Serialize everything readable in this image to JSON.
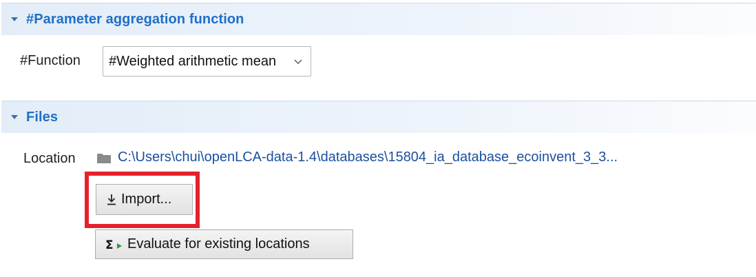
{
  "sections": {
    "parameter_aggregation": {
      "title": "#Parameter aggregation function",
      "function_label": "#Function",
      "function_selected": "#Weighted arithmetic mean"
    },
    "files": {
      "title": "Files",
      "location_label": "Location",
      "location_path": "C:\\Users\\chui\\openLCA-data-1.4\\databases\\15804_ia_database_ecoinvent_3_3...",
      "import_button_label": "Import...",
      "evaluate_button_label": "Evaluate for existing locations"
    }
  },
  "icons": {
    "twisty": "chevron-down-icon",
    "combo_arrow": "chevron-down-icon",
    "folder": "folder-icon",
    "import": "download-icon",
    "evaluate": "sigma-run-icon"
  },
  "colors": {
    "section_title": "#1e6fc7",
    "link": "#1b4fa0",
    "highlight": "#e5212b",
    "sigma_arrow": "#2e9a3a"
  }
}
